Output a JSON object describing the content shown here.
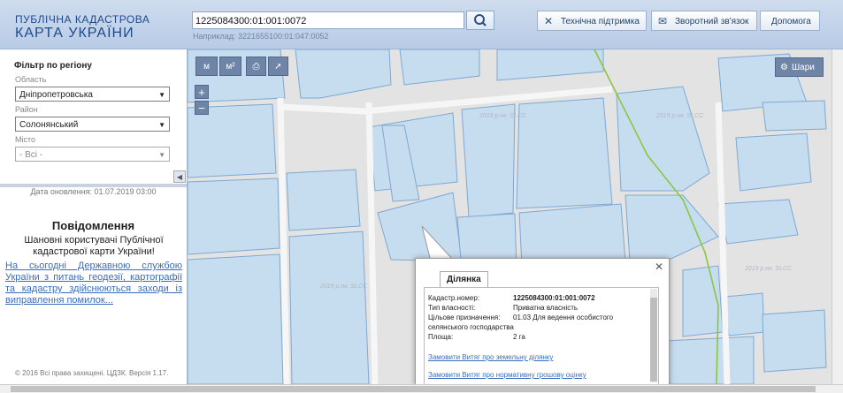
{
  "header": {
    "logo_line1": "ПУБЛІЧНА КАДАСТРОВА",
    "logo_line2": "КАРТА УКРАЇНИ",
    "search_value": "1225084300:01:001:0072",
    "search_hint": "Наприклад: 3221655100:01:047:0052",
    "support_label": "Технічна підтримка",
    "feedback_label": "Зворотний зв'язок",
    "help_label": "Допомога"
  },
  "filter": {
    "title": "Фільтр по регіону",
    "oblast_label": "Область",
    "oblast_value": "Дніпропетровська",
    "rayon_label": "Район",
    "rayon_value": "Солонянський",
    "misto_label": "Місто",
    "misto_value": "- Всі -"
  },
  "sidebar": {
    "updated": "Дата оновлення: 01.07.2019 03:00",
    "notice_title": "Повідомлення",
    "notice_text": "Шановні користувачі Публічної кадастрової карти України!",
    "notice_link": "На сьогодні Державною службою України з питань геодезії, картографії та кадастру здійснюються заходи із виправлення помилок...",
    "footer": "© 2016 Всі права захищені. ЦДЗК. Версія 1.17."
  },
  "map": {
    "tool_measure_label": "м",
    "tool_area_label": "м²",
    "zoom_in": "+",
    "zoom_out": "−",
    "layers_label": "Шари",
    "watermark": "2019 р.нк. SLCC"
  },
  "popup": {
    "tab_label": "Ділянка",
    "cadastr_label": "Кадастр.номер:",
    "cadastr_value": "1225084300:01:001:0072",
    "ownership_label": "Тип власності:",
    "ownership_value": "Приватна власність",
    "purpose_label": "Цільове призначення:",
    "purpose_value_line1": "01.03 Для ведення особистого",
    "purpose_value_line2": "селянського господарства",
    "area_label": "Площа:",
    "area_value": "2 га",
    "link1": "Замовити Витяг про земельну ділянку",
    "link2": "Замовити Витяг про нормативну грошову оцінку"
  },
  "colors": {
    "parcel_fill": "#c6dcef",
    "parcel_stroke": "#7ea8d2",
    "road": "#f4f4f4",
    "boundary": "#8cc63f",
    "header_bg": "#c8d8ed"
  }
}
